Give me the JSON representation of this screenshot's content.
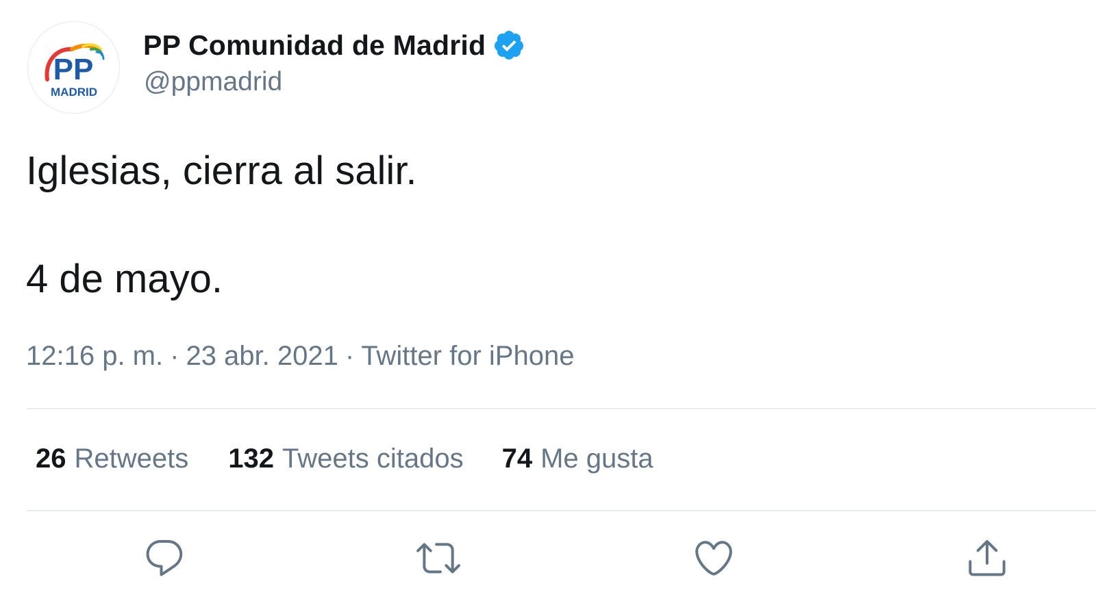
{
  "tweet": {
    "author": {
      "display_name": "PP Comunidad de Madrid",
      "handle": "@ppmadrid",
      "verified": true,
      "avatar_text": "MADRID",
      "avatar_logo": "PP"
    },
    "text_lines": [
      "Iglesias, cierra al salir.",
      "4 de mayo."
    ],
    "time": "12:16 p. m.",
    "separator": "·",
    "date": "23 abr. 2021",
    "source": "Twitter for iPhone"
  },
  "stats": {
    "retweets": {
      "count": "26",
      "label": "Retweets"
    },
    "quotes": {
      "count": "132",
      "label": "Tweets citados"
    },
    "likes": {
      "count": "74",
      "label": "Me gusta"
    }
  },
  "actions": [
    {
      "name": "reply",
      "icon": "reply-icon"
    },
    {
      "name": "retweet",
      "icon": "retweet-icon"
    },
    {
      "name": "like",
      "icon": "heart-icon"
    },
    {
      "name": "share",
      "icon": "share-icon"
    }
  ],
  "colors": {
    "text_primary": "#14171a",
    "text_secondary": "#657786",
    "verified_blue": "#1da1f2",
    "divider": "#e6ecf0",
    "logo_blue": "#1d5aa8",
    "logo_rainbow": [
      "#e53935",
      "#fb8c00",
      "#fdd835",
      "#43a047",
      "#1e88e5"
    ]
  }
}
